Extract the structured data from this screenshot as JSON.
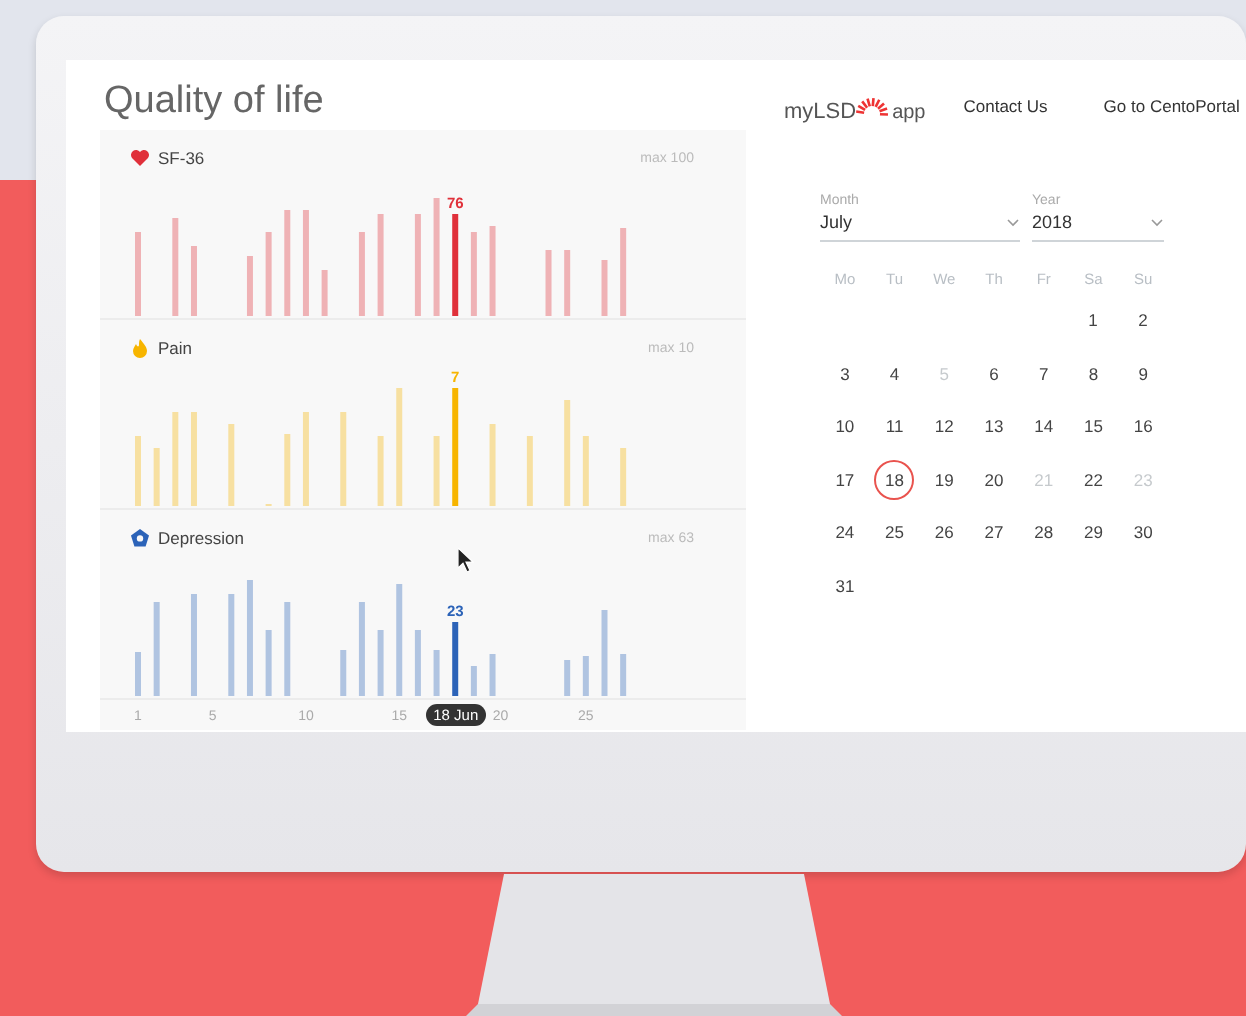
{
  "page": {
    "title": "Quality of life"
  },
  "header": {
    "logo": {
      "text": "myLSD",
      "suffix": "app"
    },
    "nav": [
      {
        "label": "Contact Us"
      },
      {
        "label": "Go to CentoPortal"
      }
    ]
  },
  "metrics": [
    {
      "kind": "heart",
      "name": "SF-36",
      "max_label": "max 100",
      "value_label": "76",
      "color": "#e0303a"
    },
    {
      "kind": "flame",
      "name": "Pain",
      "max_label": "max 10",
      "value_label": "7",
      "color": "#f7b500"
    },
    {
      "kind": "flower",
      "name": "Depression",
      "max_label": "max 63",
      "value_label": "23",
      "color": "#2c63b8"
    }
  ],
  "timeline": {
    "ticks": [
      "1",
      "5",
      "10",
      "15",
      "20",
      "25"
    ],
    "selected_label": "18 Jun"
  },
  "calendar": {
    "month": {
      "label": "Month",
      "value": "July"
    },
    "year": {
      "label": "Year",
      "value": "2018"
    },
    "weekdays": [
      "Mo",
      "Tu",
      "We",
      "Th",
      "Fr",
      "Sa",
      "Su"
    ],
    "weeks": [
      {
        "days": [
          {
            "label": "1",
            "disabled": false,
            "selected": false
          },
          {
            "label": "2",
            "disabled": false,
            "selected": false
          }
        ]
      },
      {
        "days": [
          {
            "label": "3",
            "disabled": false,
            "selected": false
          },
          {
            "label": "4",
            "disabled": false,
            "selected": false
          },
          {
            "label": "5",
            "disabled": true,
            "selected": false
          },
          {
            "label": "6",
            "disabled": false,
            "selected": false
          },
          {
            "label": "7",
            "disabled": false,
            "selected": false
          },
          {
            "label": "8",
            "disabled": false,
            "selected": false
          },
          {
            "label": "9",
            "disabled": false,
            "selected": false
          }
        ]
      },
      {
        "days": [
          {
            "label": "10",
            "disabled": false,
            "selected": false
          },
          {
            "label": "11",
            "disabled": false,
            "selected": false
          },
          {
            "label": "12",
            "disabled": false,
            "selected": false
          },
          {
            "label": "13",
            "disabled": false,
            "selected": false
          },
          {
            "label": "14",
            "disabled": false,
            "selected": false
          },
          {
            "label": "15",
            "disabled": false,
            "selected": false
          },
          {
            "label": "16",
            "disabled": false,
            "selected": false
          }
        ]
      },
      {
        "days": [
          {
            "label": "17",
            "disabled": false,
            "selected": false
          },
          {
            "label": "18",
            "disabled": false,
            "selected": true
          },
          {
            "label": "19",
            "disabled": false,
            "selected": false
          },
          {
            "label": "20",
            "disabled": false,
            "selected": false
          },
          {
            "label": "21",
            "disabled": true,
            "selected": false
          },
          {
            "label": "22",
            "disabled": false,
            "selected": false
          },
          {
            "label": "23",
            "disabled": true,
            "selected": false
          }
        ]
      },
      {
        "days": [
          {
            "label": "24",
            "disabled": false,
            "selected": false
          },
          {
            "label": "25",
            "disabled": false,
            "selected": false
          },
          {
            "label": "26",
            "disabled": false,
            "selected": false
          },
          {
            "label": "27",
            "disabled": false,
            "selected": false
          },
          {
            "label": "28",
            "disabled": false,
            "selected": false
          },
          {
            "label": "29",
            "disabled": false,
            "selected": false
          },
          {
            "label": "30",
            "disabled": false,
            "selected": false
          }
        ]
      },
      {
        "days": [
          {
            "label": "31",
            "disabled": false,
            "selected": false
          }
        ]
      }
    ]
  }
}
